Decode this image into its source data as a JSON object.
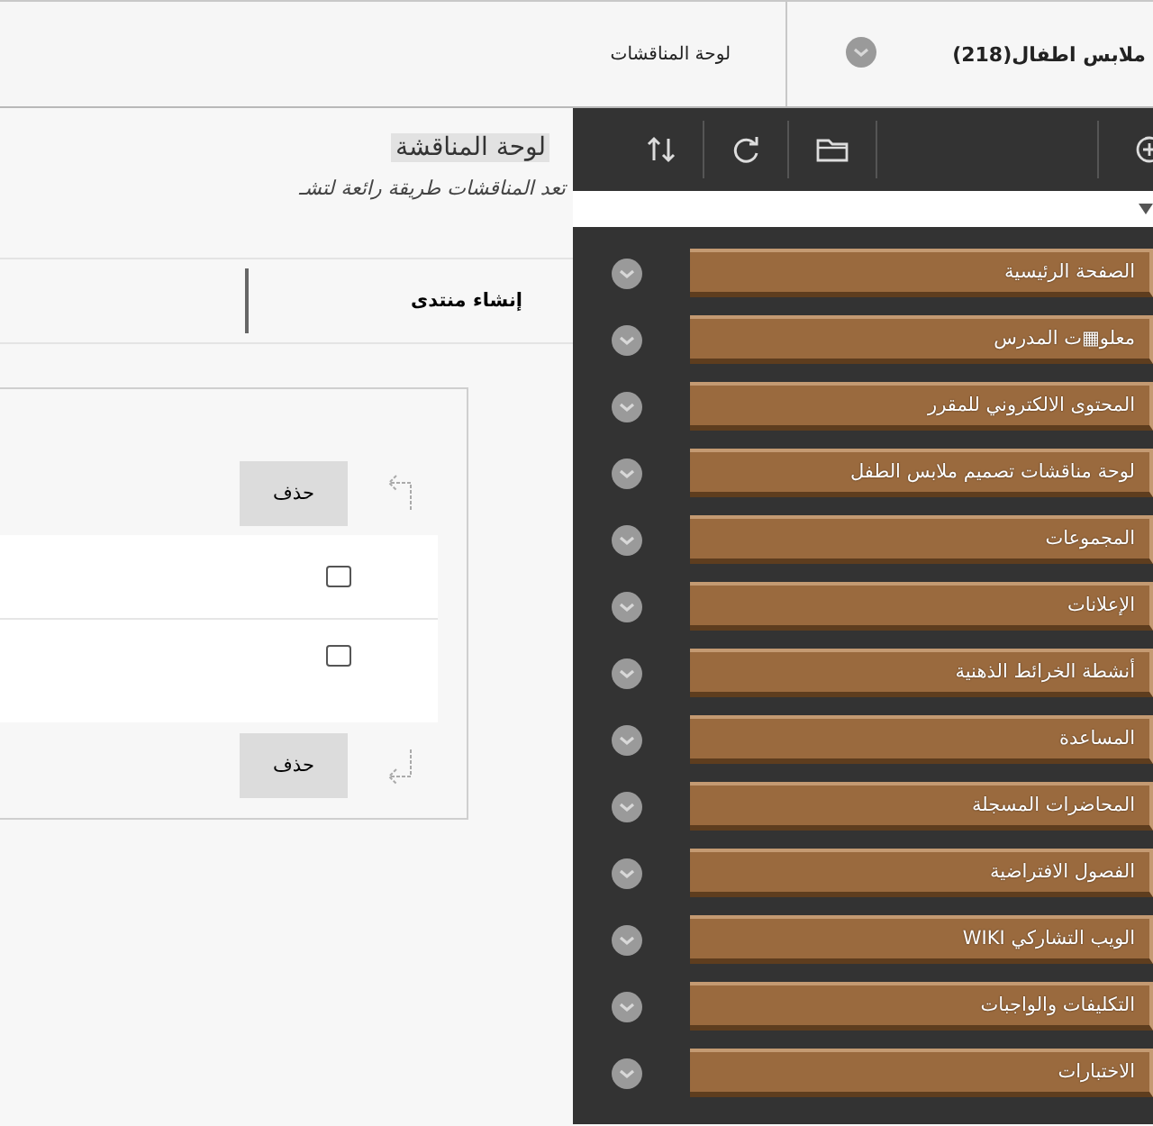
{
  "breadcrumbs": [
    {
      "label": "ملابس اطفال(218)"
    },
    {
      "label": "لوحة المناقشات"
    }
  ],
  "sidebar": {
    "items": [
      {
        "label": "الصفحة الرئيسية"
      },
      {
        "label": "معلو▦ت المدرس"
      },
      {
        "label": "المحتوى الالكتروني للمقرر"
      },
      {
        "label": "لوحة مناقشات تصميم ملابس الطفل"
      },
      {
        "label": "المجموعات"
      },
      {
        "label": "الإعلانات"
      },
      {
        "label": "أنشطة الخرائط الذهنية"
      },
      {
        "label": "المساعدة"
      },
      {
        "label": "المحاضرات المسجلة"
      },
      {
        "label": "الفصول الافتراضية"
      },
      {
        "label": "الويب التشاركي WIKI"
      },
      {
        "label": "التكليفات والواجبات"
      },
      {
        "label": "الاختبارات"
      }
    ]
  },
  "page": {
    "title": "لوحة المناقشة",
    "description": "تعد المناقشات طريقة رائعة لتشـ",
    "action": "إنشاء منتدى"
  },
  "list": {
    "delete_top": "حذف",
    "rows": [
      {
        "checked": false
      },
      {
        "checked": false
      }
    ],
    "delete_bottom": "حذف"
  }
}
